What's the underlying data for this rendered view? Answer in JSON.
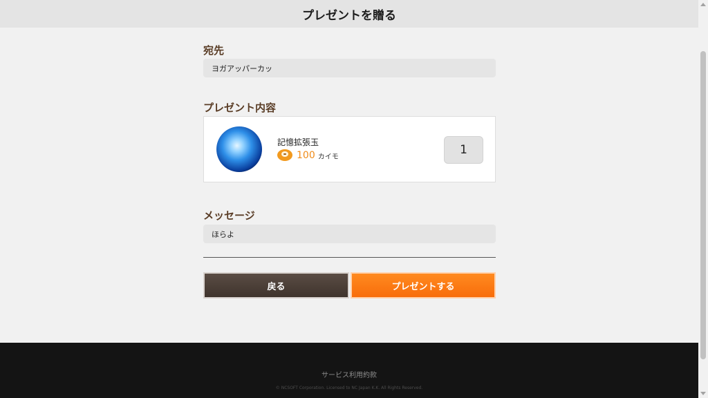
{
  "header": {
    "title": "プレゼントを贈る"
  },
  "recipient": {
    "label": "宛先",
    "value": "ヨガアッパーカッ"
  },
  "gift": {
    "label": "プレゼント内容",
    "item_name": "記憶拡張玉",
    "item_icon": "blue-orb-icon",
    "currency_icon": "kaimo-coin-icon",
    "price": "100",
    "unit": "カイモ",
    "quantity": "1"
  },
  "message": {
    "label": "メッセージ",
    "value": "ほらよ"
  },
  "buttons": {
    "back": "戻る",
    "send": "プレゼントする"
  },
  "footer": {
    "terms": "サービス利用約款",
    "copyright": "© NCSOFT Corporation. Licensed to NC Japan K.K. All Rights Reserved."
  },
  "colors": {
    "accent": "#f86d0b",
    "label": "#5a3d26",
    "back_button": "#4a3e37",
    "footer": "#141414"
  }
}
